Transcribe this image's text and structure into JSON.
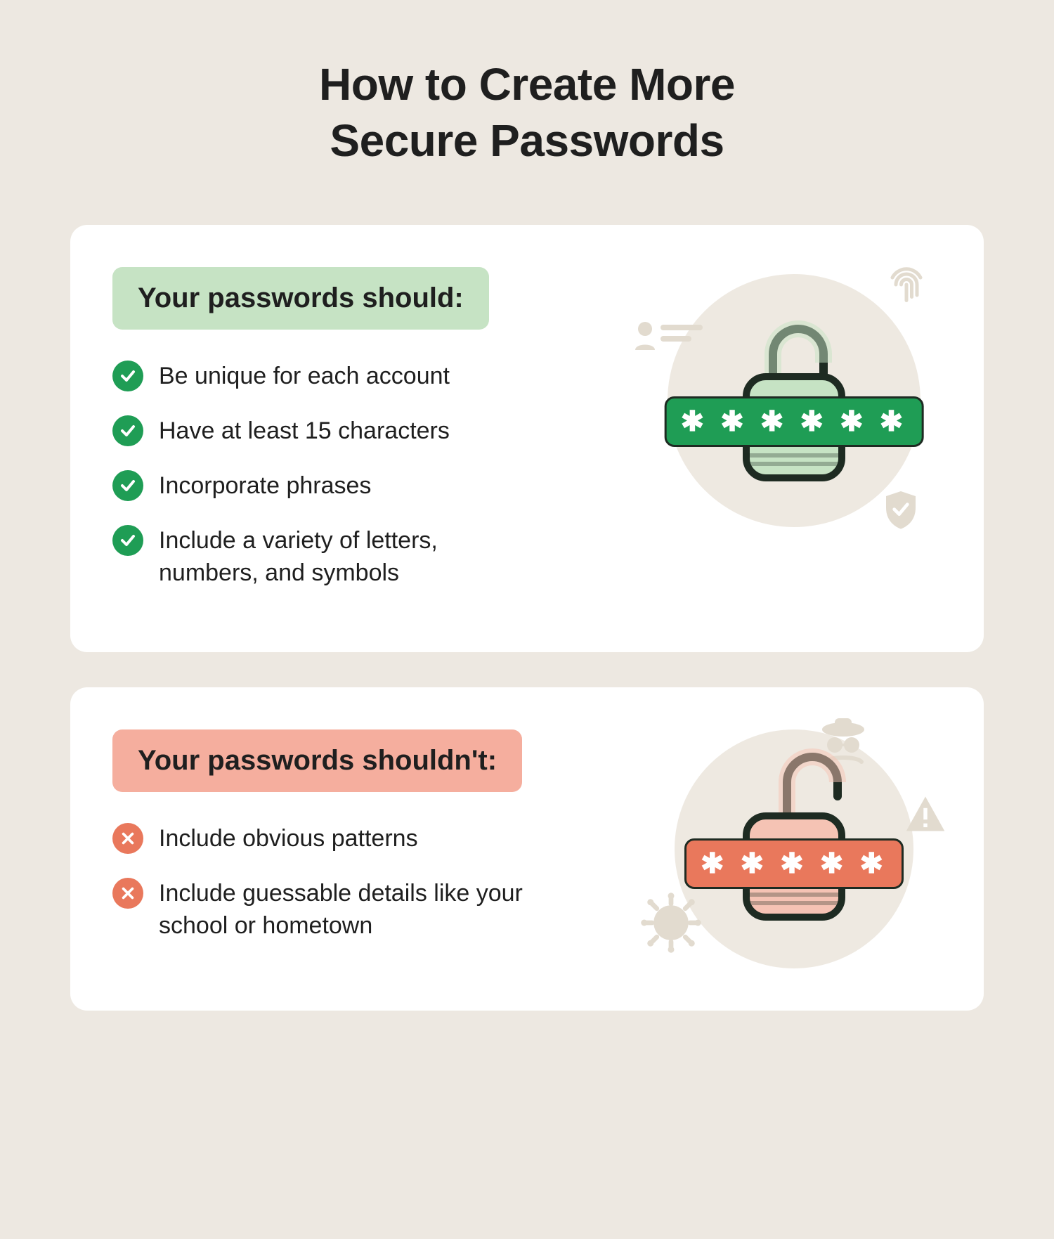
{
  "title_line1": "How to Create More",
  "title_line2": "Secure Passwords",
  "should": {
    "banner": "Your passwords should:",
    "items": [
      "Be unique for each account",
      "Have at least 15 characters",
      "Incorporate phrases",
      "Include a variety of letters, numbers, and symbols"
    ],
    "asterisks": "✱ ✱ ✱ ✱ ✱ ✱"
  },
  "shouldnt": {
    "banner": "Your passwords shouldn't:",
    "items": [
      "Include obvious patterns",
      "Include guessable details like your school or hometown"
    ],
    "asterisks": "✱ ✱ ✱ ✱ ✱"
  },
  "colors": {
    "bg": "#ede8e1",
    "card": "#ffffff",
    "green": "#1f9d55",
    "green_light": "#c6e3c4",
    "red": "#e9785c",
    "red_light": "#f5ae9e",
    "deco": "#e2dbcf",
    "text": "#1f1f1f"
  }
}
